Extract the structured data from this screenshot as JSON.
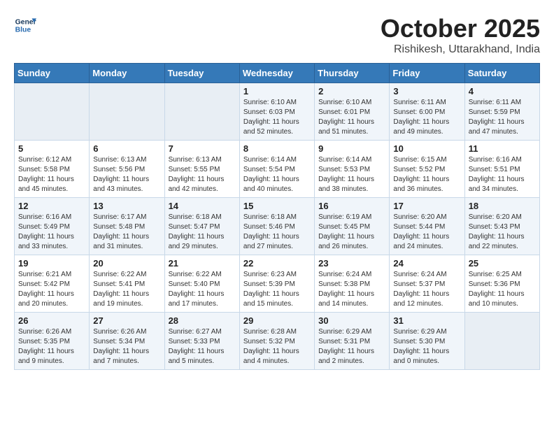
{
  "header": {
    "logo_line1": "General",
    "logo_line2": "Blue",
    "month": "October 2025",
    "location": "Rishikesh, Uttarakhand, India"
  },
  "weekdays": [
    "Sunday",
    "Monday",
    "Tuesday",
    "Wednesday",
    "Thursday",
    "Friday",
    "Saturday"
  ],
  "weeks": [
    [
      {
        "day": "",
        "info": ""
      },
      {
        "day": "",
        "info": ""
      },
      {
        "day": "",
        "info": ""
      },
      {
        "day": "1",
        "info": "Sunrise: 6:10 AM\nSunset: 6:03 PM\nDaylight: 11 hours\nand 52 minutes."
      },
      {
        "day": "2",
        "info": "Sunrise: 6:10 AM\nSunset: 6:01 PM\nDaylight: 11 hours\nand 51 minutes."
      },
      {
        "day": "3",
        "info": "Sunrise: 6:11 AM\nSunset: 6:00 PM\nDaylight: 11 hours\nand 49 minutes."
      },
      {
        "day": "4",
        "info": "Sunrise: 6:11 AM\nSunset: 5:59 PM\nDaylight: 11 hours\nand 47 minutes."
      }
    ],
    [
      {
        "day": "5",
        "info": "Sunrise: 6:12 AM\nSunset: 5:58 PM\nDaylight: 11 hours\nand 45 minutes."
      },
      {
        "day": "6",
        "info": "Sunrise: 6:13 AM\nSunset: 5:56 PM\nDaylight: 11 hours\nand 43 minutes."
      },
      {
        "day": "7",
        "info": "Sunrise: 6:13 AM\nSunset: 5:55 PM\nDaylight: 11 hours\nand 42 minutes."
      },
      {
        "day": "8",
        "info": "Sunrise: 6:14 AM\nSunset: 5:54 PM\nDaylight: 11 hours\nand 40 minutes."
      },
      {
        "day": "9",
        "info": "Sunrise: 6:14 AM\nSunset: 5:53 PM\nDaylight: 11 hours\nand 38 minutes."
      },
      {
        "day": "10",
        "info": "Sunrise: 6:15 AM\nSunset: 5:52 PM\nDaylight: 11 hours\nand 36 minutes."
      },
      {
        "day": "11",
        "info": "Sunrise: 6:16 AM\nSunset: 5:51 PM\nDaylight: 11 hours\nand 34 minutes."
      }
    ],
    [
      {
        "day": "12",
        "info": "Sunrise: 6:16 AM\nSunset: 5:49 PM\nDaylight: 11 hours\nand 33 minutes."
      },
      {
        "day": "13",
        "info": "Sunrise: 6:17 AM\nSunset: 5:48 PM\nDaylight: 11 hours\nand 31 minutes."
      },
      {
        "day": "14",
        "info": "Sunrise: 6:18 AM\nSunset: 5:47 PM\nDaylight: 11 hours\nand 29 minutes."
      },
      {
        "day": "15",
        "info": "Sunrise: 6:18 AM\nSunset: 5:46 PM\nDaylight: 11 hours\nand 27 minutes."
      },
      {
        "day": "16",
        "info": "Sunrise: 6:19 AM\nSunset: 5:45 PM\nDaylight: 11 hours\nand 26 minutes."
      },
      {
        "day": "17",
        "info": "Sunrise: 6:20 AM\nSunset: 5:44 PM\nDaylight: 11 hours\nand 24 minutes."
      },
      {
        "day": "18",
        "info": "Sunrise: 6:20 AM\nSunset: 5:43 PM\nDaylight: 11 hours\nand 22 minutes."
      }
    ],
    [
      {
        "day": "19",
        "info": "Sunrise: 6:21 AM\nSunset: 5:42 PM\nDaylight: 11 hours\nand 20 minutes."
      },
      {
        "day": "20",
        "info": "Sunrise: 6:22 AM\nSunset: 5:41 PM\nDaylight: 11 hours\nand 19 minutes."
      },
      {
        "day": "21",
        "info": "Sunrise: 6:22 AM\nSunset: 5:40 PM\nDaylight: 11 hours\nand 17 minutes."
      },
      {
        "day": "22",
        "info": "Sunrise: 6:23 AM\nSunset: 5:39 PM\nDaylight: 11 hours\nand 15 minutes."
      },
      {
        "day": "23",
        "info": "Sunrise: 6:24 AM\nSunset: 5:38 PM\nDaylight: 11 hours\nand 14 minutes."
      },
      {
        "day": "24",
        "info": "Sunrise: 6:24 AM\nSunset: 5:37 PM\nDaylight: 11 hours\nand 12 minutes."
      },
      {
        "day": "25",
        "info": "Sunrise: 6:25 AM\nSunset: 5:36 PM\nDaylight: 11 hours\nand 10 minutes."
      }
    ],
    [
      {
        "day": "26",
        "info": "Sunrise: 6:26 AM\nSunset: 5:35 PM\nDaylight: 11 hours\nand 9 minutes."
      },
      {
        "day": "27",
        "info": "Sunrise: 6:26 AM\nSunset: 5:34 PM\nDaylight: 11 hours\nand 7 minutes."
      },
      {
        "day": "28",
        "info": "Sunrise: 6:27 AM\nSunset: 5:33 PM\nDaylight: 11 hours\nand 5 minutes."
      },
      {
        "day": "29",
        "info": "Sunrise: 6:28 AM\nSunset: 5:32 PM\nDaylight: 11 hours\nand 4 minutes."
      },
      {
        "day": "30",
        "info": "Sunrise: 6:29 AM\nSunset: 5:31 PM\nDaylight: 11 hours\nand 2 minutes."
      },
      {
        "day": "31",
        "info": "Sunrise: 6:29 AM\nSunset: 5:30 PM\nDaylight: 11 hours\nand 0 minutes."
      },
      {
        "day": "",
        "info": ""
      }
    ]
  ]
}
